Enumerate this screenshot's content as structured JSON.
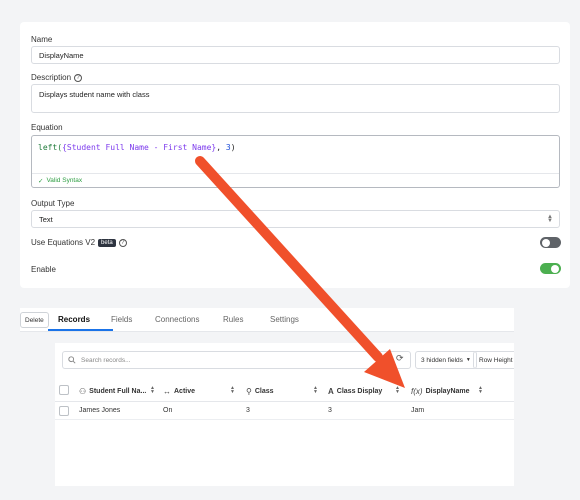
{
  "form": {
    "name_label": "Name",
    "name_value": "DisplayName",
    "description_label": "Description",
    "description_value": "Displays student name with class",
    "equation_label": "Equation",
    "equation": {
      "fn": "left(",
      "field": "{Student Full Name - First Name}",
      "rest": ", ",
      "num": "3",
      "close": ")"
    },
    "valid_syntax": "Valid Syntax",
    "output_type_label": "Output Type",
    "output_type_value": "Text",
    "use_equations_label": "Use Equations V2",
    "beta_badge": "beta",
    "use_equations_on": false,
    "enable_label": "Enable",
    "enable_on": true
  },
  "tabs": {
    "delete": "Delete",
    "items": [
      "Records",
      "Fields",
      "Connections",
      "Rules",
      "Settings"
    ],
    "active": "Records"
  },
  "grid": {
    "search_placeholder": "Search records...",
    "hidden_fields": "3 hidden fields",
    "row_height": "Row Height",
    "columns": [
      {
        "label": "Student Full Na...",
        "icon": "person-icon"
      },
      {
        "label": "Active",
        "icon": "toggle-arrows-icon"
      },
      {
        "label": "Class",
        "icon": "link-icon"
      },
      {
        "label": "Class Display",
        "icon": "text-a-icon"
      },
      {
        "label": "DisplayName",
        "icon": "fx-icon"
      }
    ],
    "rows": [
      [
        "James Jones",
        "On",
        "3",
        "3",
        "Jam"
      ]
    ]
  },
  "colors": {
    "accent_blue": "#1a73e8",
    "toggle_on": "#4caf50",
    "arrow": "#f0502b",
    "valid_green": "#2e9e43"
  }
}
